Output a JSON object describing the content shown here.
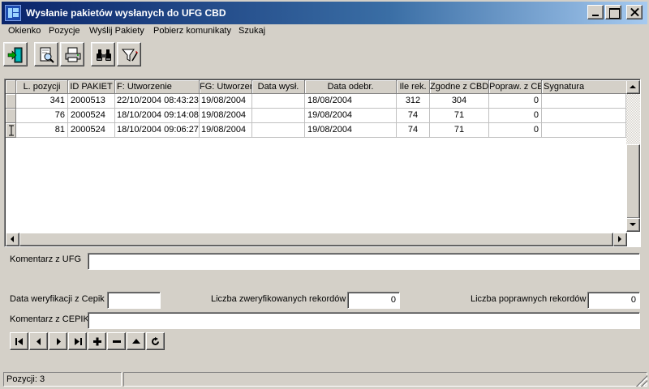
{
  "window": {
    "title": "Wysłanie pakietów wysłanych do UFG CBD"
  },
  "menu": [
    "Okienko",
    "Pozycje",
    "Wyślij Pakiety",
    "Pobierz komunikaty",
    "Szukaj"
  ],
  "toolbar": {
    "icons": [
      "exit-icon",
      "preview-icon",
      "print-icon",
      "binoculars-icon",
      "filter-icon"
    ]
  },
  "grid": {
    "columns": [
      "L. pozycji",
      "ID PAKIET",
      "F: Utworzenie",
      "FG: Utworzen",
      "Data wysł.",
      "Data odebr.",
      "Ile rek.",
      "Zgodne z CBD",
      "Popraw. z CE",
      "Sygnatura"
    ],
    "rows": [
      [
        "341",
        "2000513",
        "22/10/2004 08:43:23",
        "19/08/2004",
        "",
        "18/08/2004",
        "312",
        "304",
        "0",
        ""
      ],
      [
        "76",
        "2000524",
        "18/10/2004 09:14:08",
        "19/08/2004",
        "",
        "19/08/2004",
        "74",
        "71",
        "0",
        ""
      ],
      [
        "81",
        "2000524",
        "18/10/2004 09:06:27",
        "19/08/2004",
        "",
        "19/08/2004",
        "74",
        "71",
        "0",
        ""
      ]
    ]
  },
  "form": {
    "komentarz_ufg_label": "Komentarz z UFG",
    "komentarz_ufg_value": "",
    "data_weryfikacji_label": "Data weryfikacji z Cepik",
    "data_weryfikacji_value": "",
    "liczba_zweryfikowanych_label": "Liczba zweryfikowanych rekordów",
    "liczba_zweryfikowanych_value": "0",
    "liczba_poprawnych_label": "Liczba poprawnych rekordów",
    "liczba_poprawnych_value": "0",
    "komentarz_cepik_label": "Komentarz z CEPIK",
    "komentarz_cepik_value": ""
  },
  "navigator": [
    "first-icon",
    "prior-icon",
    "next-icon",
    "last-icon",
    "insert-icon",
    "delete-icon",
    "edit-icon",
    "refresh-icon"
  ],
  "status": {
    "text": "Pozycji: 3",
    "secondary": ""
  }
}
